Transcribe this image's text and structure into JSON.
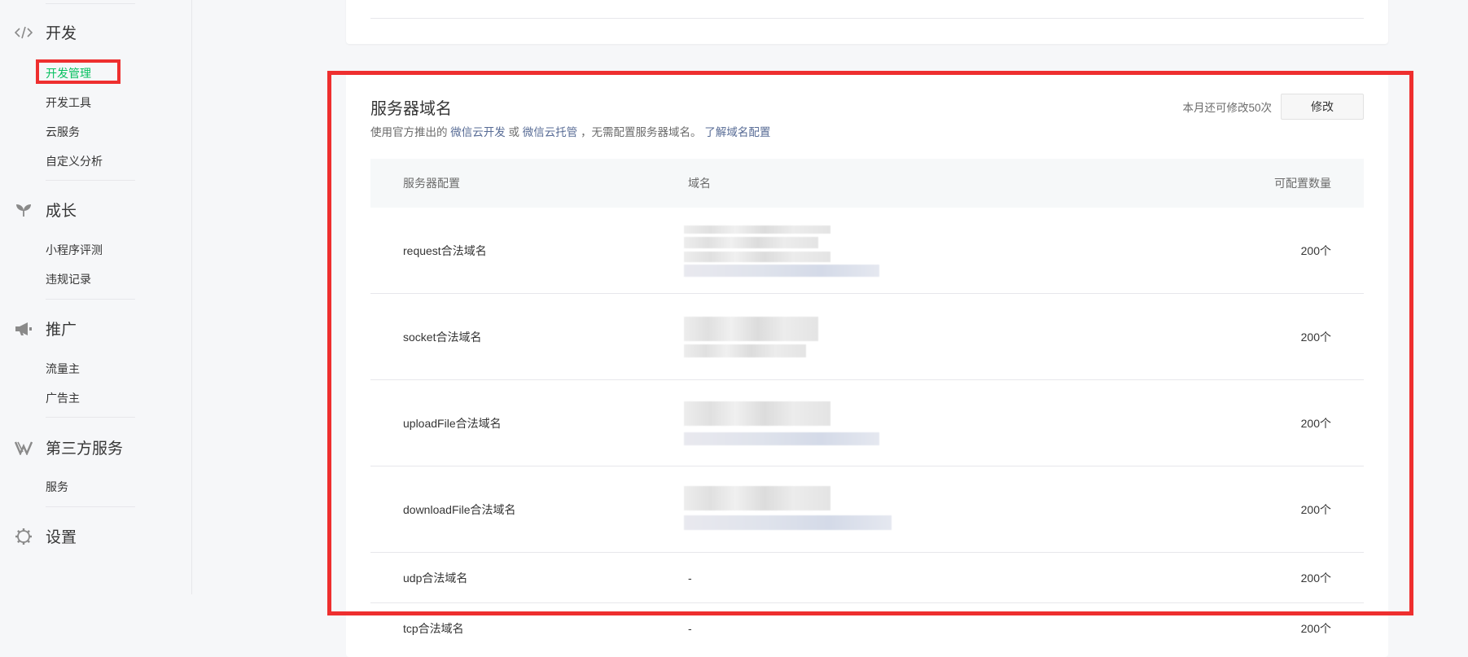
{
  "sidebar": {
    "groups": [
      {
        "title": "开发",
        "icon": "code-icon",
        "items": [
          "开发管理",
          "开发工具",
          "云服务",
          "自定义分析"
        ]
      },
      {
        "title": "成长",
        "icon": "sprout-icon",
        "items": [
          "小程序评测",
          "违规记录"
        ]
      },
      {
        "title": "推广",
        "icon": "megaphone-icon",
        "items": [
          "流量主",
          "广告主"
        ]
      },
      {
        "title": "第三方服务",
        "icon": "third-party-icon",
        "items": [
          "服务"
        ]
      },
      {
        "title": "设置",
        "icon": "gear-icon",
        "items": []
      }
    ],
    "active_item": "开发管理"
  },
  "server_domain": {
    "title": "服务器域名",
    "desc_prefix": "使用官方推出的",
    "link_cloud_dev": "微信云开发",
    "desc_or": "或",
    "link_cloud_host": "微信云托管",
    "desc_suffix": "，无需配置服务器域名。",
    "link_learn": "了解域名配置",
    "quota_text": "本月还可修改50次",
    "modify_button": "修改",
    "table": {
      "headers": [
        "服务器配置",
        "域名",
        "可配置数量"
      ],
      "rows": [
        {
          "name": "request合法域名",
          "domain": "",
          "count": "200个"
        },
        {
          "name": "socket合法域名",
          "domain": "",
          "count": "200个"
        },
        {
          "name": "uploadFile合法域名",
          "domain": "",
          "count": "200个"
        },
        {
          "name": "downloadFile合法域名",
          "domain": "",
          "count": "200个"
        },
        {
          "name": "udp合法域名",
          "domain": "-",
          "count": "200个"
        },
        {
          "name": "tcp合法域名",
          "domain": "-",
          "count": "200个"
        }
      ]
    }
  },
  "colors": {
    "accent_green": "#07c160",
    "link_blue": "#576b95",
    "highlight_red": "#ee2f2f"
  }
}
